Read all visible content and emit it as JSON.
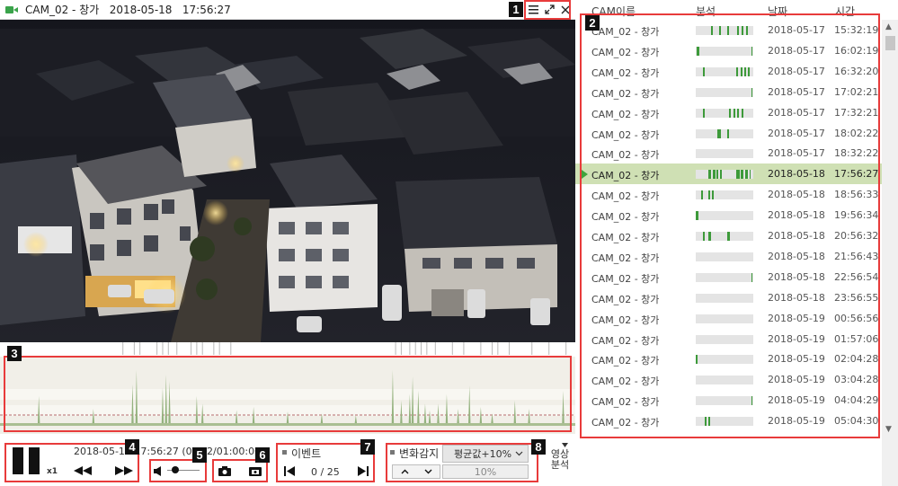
{
  "window": {
    "title": "CAM_02 - 창가   2018-05-18   17:56:27",
    "menu_icon": "hamburger-icon",
    "fullscreen_icon": "expand-icon",
    "close_icon": "close-icon"
  },
  "badges": [
    "1",
    "2",
    "3",
    "4",
    "5",
    "6",
    "7",
    "8"
  ],
  "playback": {
    "timestamp": "2018-05-18 17:56:27 (00:20:00) / 2018-05-18 17:56:27/01:00:00",
    "visible_left": "2018-05-18 17:56:27 (00:",
    "visible_right": "2/01:00:00",
    "speed": "x1",
    "pause_icon": "pause-icon",
    "rewind_icon": "rewind-icon",
    "forward_icon": "fast-forward-icon"
  },
  "volume": {
    "icon": "speaker-icon",
    "level": 0.25
  },
  "snapshot": {
    "camera_icon": "camera-icon",
    "save_icon": "save-snapshot-icon"
  },
  "events": {
    "label": "이벤트",
    "counter": "0 / 25",
    "prev_icon": "skip-back-icon",
    "next_icon": "skip-forward-icon"
  },
  "change_detect": {
    "label": "변화감지",
    "select_value": "평균값+10%",
    "percent": "10%",
    "up_icon": "chevron-up-icon",
    "down_icon": "chevron-down-icon"
  },
  "video_analysis": {
    "label_line1": "영상",
    "label_line2": "분석"
  },
  "list": {
    "headers": {
      "name": "CAM이름",
      "analysis": "분석",
      "date": "날짜",
      "time": "시간"
    },
    "rows": [
      {
        "name": "CAM_02 - 창가",
        "date": "2018-05-17",
        "time": "15:32:19",
        "marks": [
          [
            0.27,
            0.03
          ],
          [
            0.4,
            0.03
          ],
          [
            0.55,
            0.03
          ],
          [
            0.72,
            0.03
          ],
          [
            0.8,
            0.03
          ],
          [
            0.87,
            0.03
          ]
        ]
      },
      {
        "name": "CAM_02 - 창가",
        "date": "2018-05-17",
        "time": "16:02:19",
        "marks": [
          [
            0.02,
            0.04
          ],
          [
            0.97,
            0.02
          ]
        ]
      },
      {
        "name": "CAM_02 - 창가",
        "date": "2018-05-17",
        "time": "16:32:20",
        "marks": [
          [
            0.12,
            0.03
          ],
          [
            0.7,
            0.03
          ],
          [
            0.78,
            0.03
          ],
          [
            0.84,
            0.03
          ],
          [
            0.9,
            0.03
          ]
        ]
      },
      {
        "name": "CAM_02 - 창가",
        "date": "2018-05-17",
        "time": "17:02:21",
        "marks": [
          [
            0.97,
            0.02
          ]
        ]
      },
      {
        "name": "CAM_02 - 창가",
        "date": "2018-05-17",
        "time": "17:32:21",
        "marks": [
          [
            0.12,
            0.03
          ],
          [
            0.58,
            0.03
          ],
          [
            0.65,
            0.03
          ],
          [
            0.72,
            0.03
          ],
          [
            0.8,
            0.03
          ]
        ]
      },
      {
        "name": "CAM_02 - 창가",
        "date": "2018-05-17",
        "time": "18:02:22",
        "marks": [
          [
            0.38,
            0.05
          ],
          [
            0.55,
            0.03
          ]
        ]
      },
      {
        "name": "CAM_02 - 창가",
        "date": "2018-05-17",
        "time": "18:32:22",
        "marks": []
      },
      {
        "name": "CAM_02 - 창가",
        "date": "2018-05-18",
        "time": "17:56:27",
        "selected": true,
        "marks": [
          [
            0.22,
            0.04
          ],
          [
            0.3,
            0.04
          ],
          [
            0.36,
            0.03
          ],
          [
            0.42,
            0.03
          ],
          [
            0.7,
            0.06
          ],
          [
            0.78,
            0.05
          ],
          [
            0.86,
            0.04
          ],
          [
            0.93,
            0.03
          ]
        ]
      },
      {
        "name": "CAM_02 - 창가",
        "date": "2018-05-18",
        "time": "18:56:33",
        "marks": [
          [
            0.1,
            0.03
          ],
          [
            0.22,
            0.03
          ],
          [
            0.28,
            0.03
          ]
        ]
      },
      {
        "name": "CAM_02 - 창가",
        "date": "2018-05-18",
        "time": "19:56:34",
        "marks": [
          [
            0.0,
            0.04
          ]
        ]
      },
      {
        "name": "CAM_02 - 창가",
        "date": "2018-05-18",
        "time": "20:56:32",
        "marks": [
          [
            0.12,
            0.04
          ],
          [
            0.22,
            0.04
          ],
          [
            0.55,
            0.05
          ]
        ]
      },
      {
        "name": "CAM_02 - 창가",
        "date": "2018-05-18",
        "time": "21:56:43",
        "marks": []
      },
      {
        "name": "CAM_02 - 창가",
        "date": "2018-05-18",
        "time": "22:56:54",
        "marks": [
          [
            0.97,
            0.02
          ]
        ]
      },
      {
        "name": "CAM_02 - 창가",
        "date": "2018-05-18",
        "time": "23:56:55",
        "marks": []
      },
      {
        "name": "CAM_02 - 창가",
        "date": "2018-05-19",
        "time": "00:56:56",
        "marks": []
      },
      {
        "name": "CAM_02 - 창가",
        "date": "2018-05-19",
        "time": "01:57:06",
        "marks": []
      },
      {
        "name": "CAM_02 - 창가",
        "date": "2018-05-19",
        "time": "02:04:28",
        "marks": [
          [
            0.0,
            0.03
          ]
        ]
      },
      {
        "name": "CAM_02 - 창가",
        "date": "2018-05-19",
        "time": "03:04:28",
        "marks": []
      },
      {
        "name": "CAM_02 - 창가",
        "date": "2018-05-19",
        "time": "04:04:29",
        "marks": [
          [
            0.97,
            0.02
          ]
        ]
      },
      {
        "name": "CAM_02 - 창가",
        "date": "2018-05-19",
        "time": "05:04:30",
        "marks": [
          [
            0.15,
            0.03
          ],
          [
            0.22,
            0.03
          ]
        ]
      }
    ]
  },
  "timeline": {
    "spikes": [
      [
        0.062,
        0.42
      ],
      [
        0.158,
        0.22
      ],
      [
        0.227,
        0.6
      ],
      [
        0.234,
        0.82
      ],
      [
        0.28,
        0.55
      ],
      [
        0.286,
        0.75
      ],
      [
        0.292,
        0.65
      ],
      [
        0.34,
        0.42
      ],
      [
        0.35,
        0.3
      ],
      [
        0.41,
        0.2
      ],
      [
        0.44,
        0.25
      ],
      [
        0.5,
        0.18
      ],
      [
        0.56,
        0.15
      ],
      [
        0.62,
        0.12
      ],
      [
        0.685,
        0.82
      ],
      [
        0.7,
        0.35
      ],
      [
        0.715,
        0.45
      ],
      [
        0.72,
        0.72
      ],
      [
        0.73,
        0.5
      ],
      [
        0.742,
        0.3
      ],
      [
        0.75,
        0.2
      ],
      [
        0.765,
        0.3
      ],
      [
        0.78,
        0.45
      ],
      [
        0.8,
        0.22
      ],
      [
        0.82,
        0.58
      ],
      [
        0.84,
        0.25
      ],
      [
        0.86,
        0.15
      ],
      [
        0.9,
        0.35
      ],
      [
        0.925,
        0.22
      ],
      [
        0.985,
        0.5
      ]
    ],
    "top_ticks": [
      0.21,
      0.23,
      0.24,
      0.27,
      0.28,
      0.29,
      0.305,
      0.33,
      0.34,
      0.35,
      0.37,
      0.38,
      0.4,
      0.69,
      0.7,
      0.715,
      0.725,
      0.735,
      0.745,
      0.76,
      0.79,
      0.81,
      0.84,
      0.86,
      0.87,
      0.89,
      0.93,
      0.96,
      0.99
    ]
  }
}
